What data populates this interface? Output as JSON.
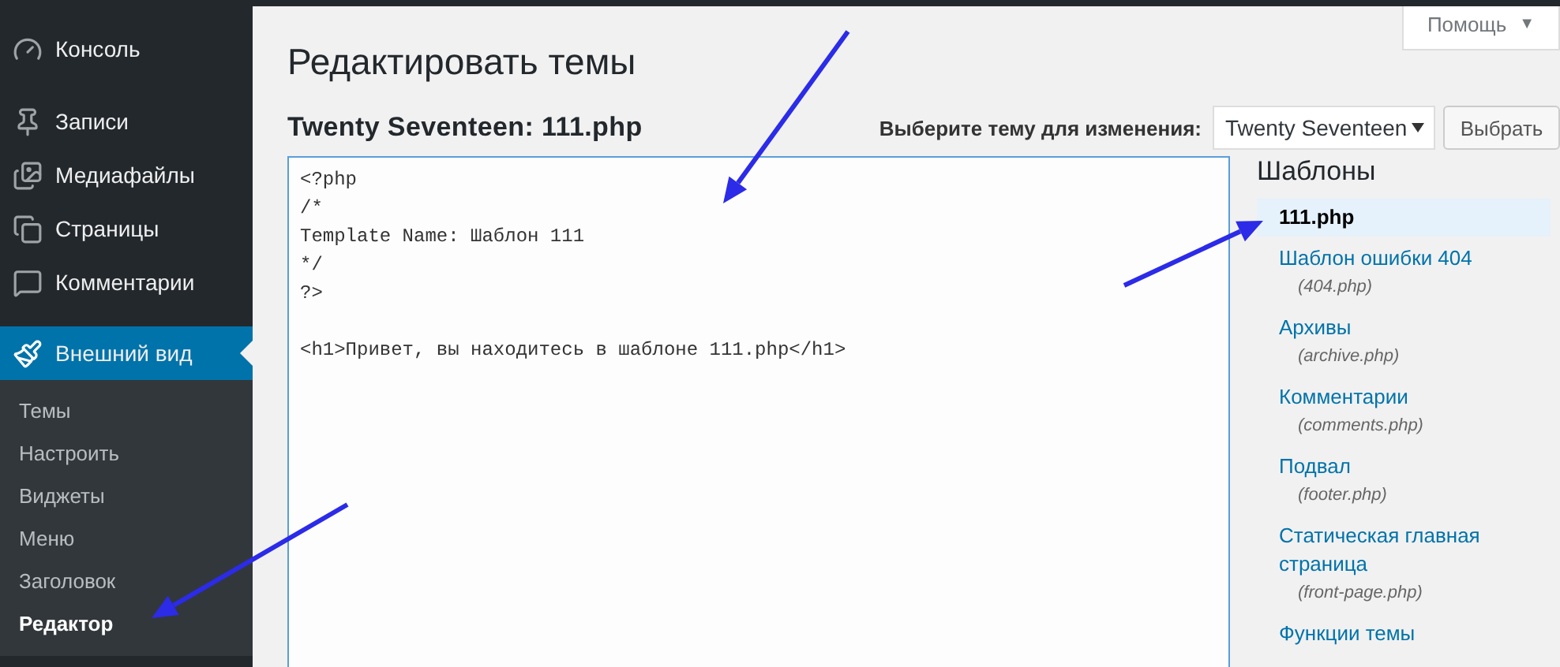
{
  "sidebar": {
    "items": [
      {
        "label": "Консоль",
        "selected": false
      },
      {
        "label": "Записи",
        "selected": false
      },
      {
        "label": "Медиафайлы",
        "selected": false
      },
      {
        "label": "Страницы",
        "selected": false
      },
      {
        "label": "Комментарии",
        "selected": false
      },
      {
        "label": "Внешний вид",
        "selected": true
      }
    ],
    "submenu": [
      {
        "label": "Темы",
        "selected": false
      },
      {
        "label": "Настроить",
        "selected": false
      },
      {
        "label": "Виджеты",
        "selected": false
      },
      {
        "label": "Меню",
        "selected": false
      },
      {
        "label": "Заголовок",
        "selected": false
      },
      {
        "label": "Редактор",
        "selected": true
      }
    ]
  },
  "help_button": {
    "label": "Помощь",
    "caret": "▼"
  },
  "page_title": "Редактировать темы",
  "file_title": "Twenty Seventeen: 111.php",
  "theme_picker": {
    "label": "Выберите тему для изменения:",
    "value": "Twenty Seventeen",
    "button": "Выбрать"
  },
  "editor": {
    "blocks": [
      [
        "<?php",
        "/*",
        "Template Name: Шаблон 111",
        "*/",
        "?>"
      ],
      [
        "<h1>Привет, вы находитесь в шаблоне 111.php</h1>"
      ]
    ]
  },
  "templates": {
    "heading": "Шаблоны",
    "items": [
      {
        "name": "111.php",
        "selected": true
      },
      {
        "name": "Шаблон ошибки 404",
        "file": "(404.php)",
        "selected": false
      },
      {
        "name": "Архивы",
        "file": "(archive.php)",
        "selected": false
      },
      {
        "name": "Комментарии",
        "file": "(comments.php)",
        "selected": false
      },
      {
        "name": "Подвал",
        "file": "(footer.php)",
        "selected": false
      },
      {
        "name": "Статическая главная страница",
        "file": "(front-page.php)",
        "selected": false
      },
      {
        "name": "Функции темы",
        "selected": false
      }
    ]
  }
}
